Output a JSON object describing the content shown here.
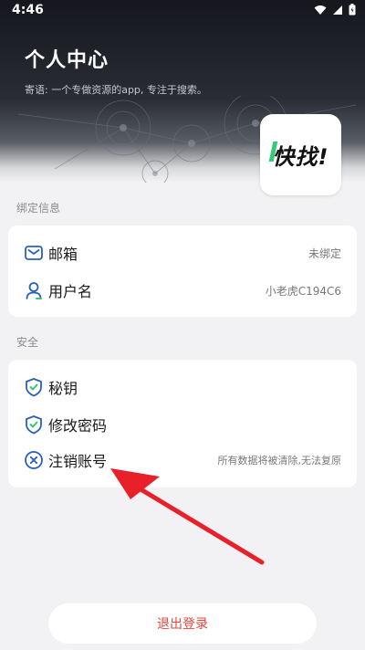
{
  "status_bar": {
    "time": "4:46"
  },
  "header": {
    "title": "个人中心",
    "motto": "寄语: 一个专做资源的app, 专注于搜索。"
  },
  "app_logo": {
    "text": "快找!"
  },
  "binding": {
    "section_label": "绑定信息",
    "items": [
      {
        "label": "邮箱",
        "value": "未绑定",
        "icon": "mail-icon"
      },
      {
        "label": "用户名",
        "value": "小老虎C194C6",
        "icon": "user-icon"
      }
    ]
  },
  "security": {
    "section_label": "安全",
    "items": [
      {
        "label": "秘钥",
        "value": "",
        "icon": "shield-check-icon"
      },
      {
        "label": "修改密码",
        "value": "",
        "icon": "shield-check-icon"
      },
      {
        "label": "注销账号",
        "value": "所有数据将被清除,无法复原",
        "icon": "circle-x-icon"
      }
    ]
  },
  "logout_label": "退出登录",
  "colors": {
    "accent": "#e8453c",
    "icon_blue": "#2b5fb9",
    "arrow_red": "#e8202a"
  }
}
